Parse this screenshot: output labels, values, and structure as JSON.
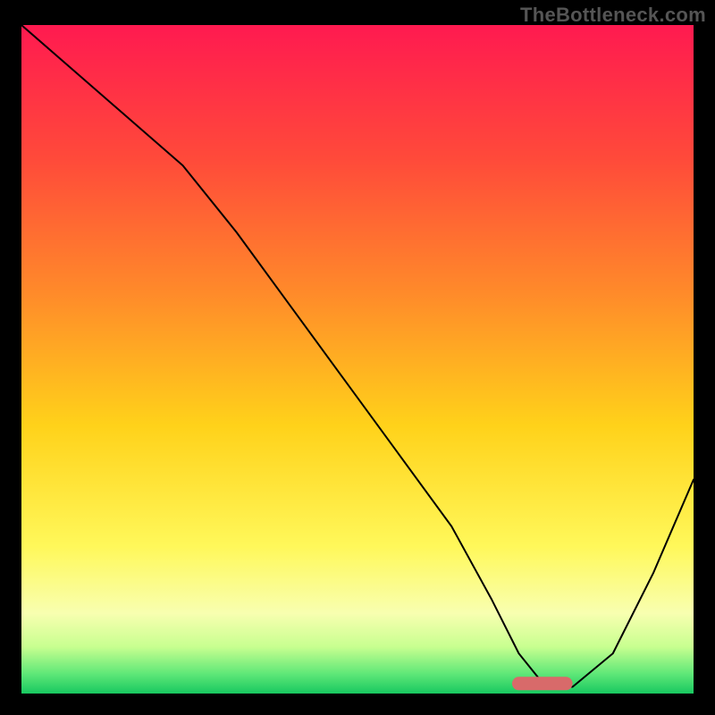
{
  "watermark": "TheBottleneck.com",
  "chart_data": {
    "type": "line",
    "title": "",
    "xlabel": "",
    "ylabel": "",
    "xlim": [
      0,
      100
    ],
    "ylim": [
      0,
      100
    ],
    "grid": false,
    "legend": false,
    "series": [
      {
        "name": "curve",
        "x": [
          0,
          8,
          16,
          24,
          32,
          40,
          48,
          56,
          64,
          70,
          74,
          78,
          82,
          88,
          94,
          100
        ],
        "y": [
          100,
          93,
          86,
          79,
          69,
          58,
          47,
          36,
          25,
          14,
          6,
          1,
          1,
          6,
          18,
          32
        ],
        "note": "y is percent height (0 = bottom green band, 100 = top). Values read off the image; no numeric axis labels exist."
      }
    ],
    "background_gradient_stops": [
      {
        "offset": 0.0,
        "color": "#ff1a50"
      },
      {
        "offset": 0.2,
        "color": "#ff4a3a"
      },
      {
        "offset": 0.4,
        "color": "#ff8a2a"
      },
      {
        "offset": 0.6,
        "color": "#ffd21a"
      },
      {
        "offset": 0.78,
        "color": "#fff85a"
      },
      {
        "offset": 0.88,
        "color": "#f8ffb0"
      },
      {
        "offset": 0.93,
        "color": "#c8ff90"
      },
      {
        "offset": 0.97,
        "color": "#60e878"
      },
      {
        "offset": 1.0,
        "color": "#18c860"
      }
    ],
    "marker": {
      "x_range": [
        73,
        82
      ],
      "y": 1.5,
      "color": "#d86a6a",
      "note": "red pill marker sitting in the green trough"
    }
  }
}
